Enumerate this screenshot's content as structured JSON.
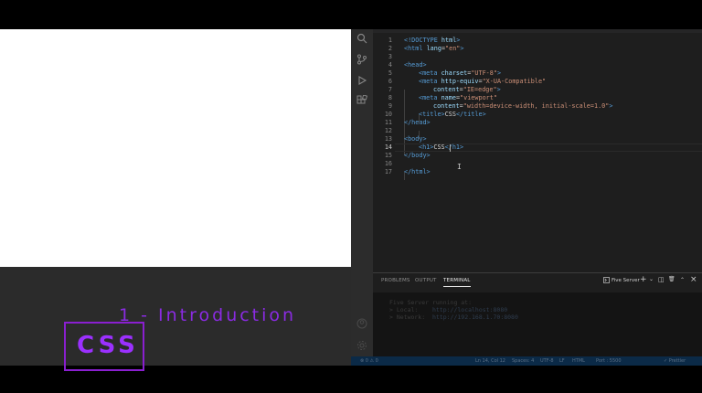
{
  "editor": {
    "lines": [
      {
        "n": "1",
        "parts": [
          {
            "t": "<!DOCTYPE ",
            "c": "tag"
          },
          {
            "t": "html",
            "c": "attr"
          },
          {
            "t": ">",
            "c": "tag"
          }
        ]
      },
      {
        "n": "2",
        "parts": [
          {
            "t": "<html ",
            "c": "tag"
          },
          {
            "t": "lang",
            "c": "attr"
          },
          {
            "t": "=",
            "c": "txt"
          },
          {
            "t": "\"en\"",
            "c": "str"
          },
          {
            "t": ">",
            "c": "tag"
          }
        ]
      },
      {
        "n": "3",
        "parts": []
      },
      {
        "n": "4",
        "parts": [
          {
            "t": "<head>",
            "c": "tag"
          }
        ]
      },
      {
        "n": "5",
        "indent": 1,
        "parts": [
          {
            "t": "<meta ",
            "c": "tag"
          },
          {
            "t": "charset",
            "c": "attr"
          },
          {
            "t": "=",
            "c": "txt"
          },
          {
            "t": "\"UTF-8\"",
            "c": "str"
          },
          {
            "t": ">",
            "c": "tag"
          }
        ]
      },
      {
        "n": "6",
        "indent": 1,
        "parts": [
          {
            "t": "<meta ",
            "c": "tag"
          },
          {
            "t": "http-equiv",
            "c": "attr"
          },
          {
            "t": "=",
            "c": "txt"
          },
          {
            "t": "\"X-UA-Compatible\"",
            "c": "str"
          }
        ]
      },
      {
        "n": "7",
        "indent": 2,
        "parts": [
          {
            "t": "content",
            "c": "attr"
          },
          {
            "t": "=",
            "c": "txt"
          },
          {
            "t": "\"IE=edge\"",
            "c": "str"
          },
          {
            "t": ">",
            "c": "tag"
          }
        ]
      },
      {
        "n": "8",
        "indent": 1,
        "parts": [
          {
            "t": "<meta ",
            "c": "tag"
          },
          {
            "t": "name",
            "c": "attr"
          },
          {
            "t": "=",
            "c": "txt"
          },
          {
            "t": "\"viewport\"",
            "c": "str"
          }
        ]
      },
      {
        "n": "9",
        "indent": 2,
        "parts": [
          {
            "t": "content",
            "c": "attr"
          },
          {
            "t": "=",
            "c": "txt"
          },
          {
            "t": "\"width=device-width, initial-scale=1.0\"",
            "c": "str"
          },
          {
            "t": ">",
            "c": "tag"
          }
        ]
      },
      {
        "n": "10",
        "indent": 1,
        "parts": [
          {
            "t": "<title>",
            "c": "tag"
          },
          {
            "t": "CSS",
            "c": "txt"
          },
          {
            "t": "</title>",
            "c": "tag"
          }
        ]
      },
      {
        "n": "11",
        "parts": [
          {
            "t": "</head>",
            "c": "tag"
          }
        ]
      },
      {
        "n": "12",
        "parts": []
      },
      {
        "n": "13",
        "parts": [
          {
            "t": "<body>",
            "c": "tag"
          }
        ]
      },
      {
        "n": "14",
        "indent": 1,
        "active": true,
        "parts": [
          {
            "t": "<h1>",
            "c": "tag"
          },
          {
            "t": "CSS",
            "c": "txt"
          },
          {
            "t": "</h1>",
            "c": "tag"
          }
        ]
      },
      {
        "n": "15",
        "parts": [
          {
            "t": "</body>",
            "c": "tag"
          }
        ]
      },
      {
        "n": "16",
        "parts": []
      },
      {
        "n": "17",
        "parts": [
          {
            "t": "</html>",
            "c": "tag"
          }
        ]
      }
    ]
  },
  "panel": {
    "tabs": [
      "PROBLEMS",
      "OUTPUT",
      "TERMINAL"
    ],
    "active_tab": "TERMINAL",
    "terminal_name": "Five Server",
    "controls": {
      "add": "+",
      "dropdown": "⌄",
      "split": "◫",
      "trash": "🗑",
      "more": "⌃",
      "close": "×"
    }
  },
  "terminal": {
    "lines": [
      {
        "label": "Five Server running at:",
        "url": ""
      },
      {
        "label": "> Local:    ",
        "url": "http://localhost:8080"
      },
      {
        "label": "> Network:  ",
        "url": "http://192.168.1.70:8080"
      }
    ]
  },
  "statusbar": {
    "left": "⊗ 0 ⚠ 0",
    "position": "Ln 14, Col 12",
    "spaces": "Spaces: 4",
    "encoding": "UTF-8",
    "eol": "LF",
    "language": "HTML",
    "server": "Port : 5500",
    "prettier": "✓ Prettier"
  },
  "overlay": {
    "title": "1 - Introduction",
    "logo": "CSS"
  },
  "colors": {
    "accent": "#8a2be2",
    "editor_bg": "#1e1e1e",
    "statusbar_bg": "#0b2a47"
  }
}
